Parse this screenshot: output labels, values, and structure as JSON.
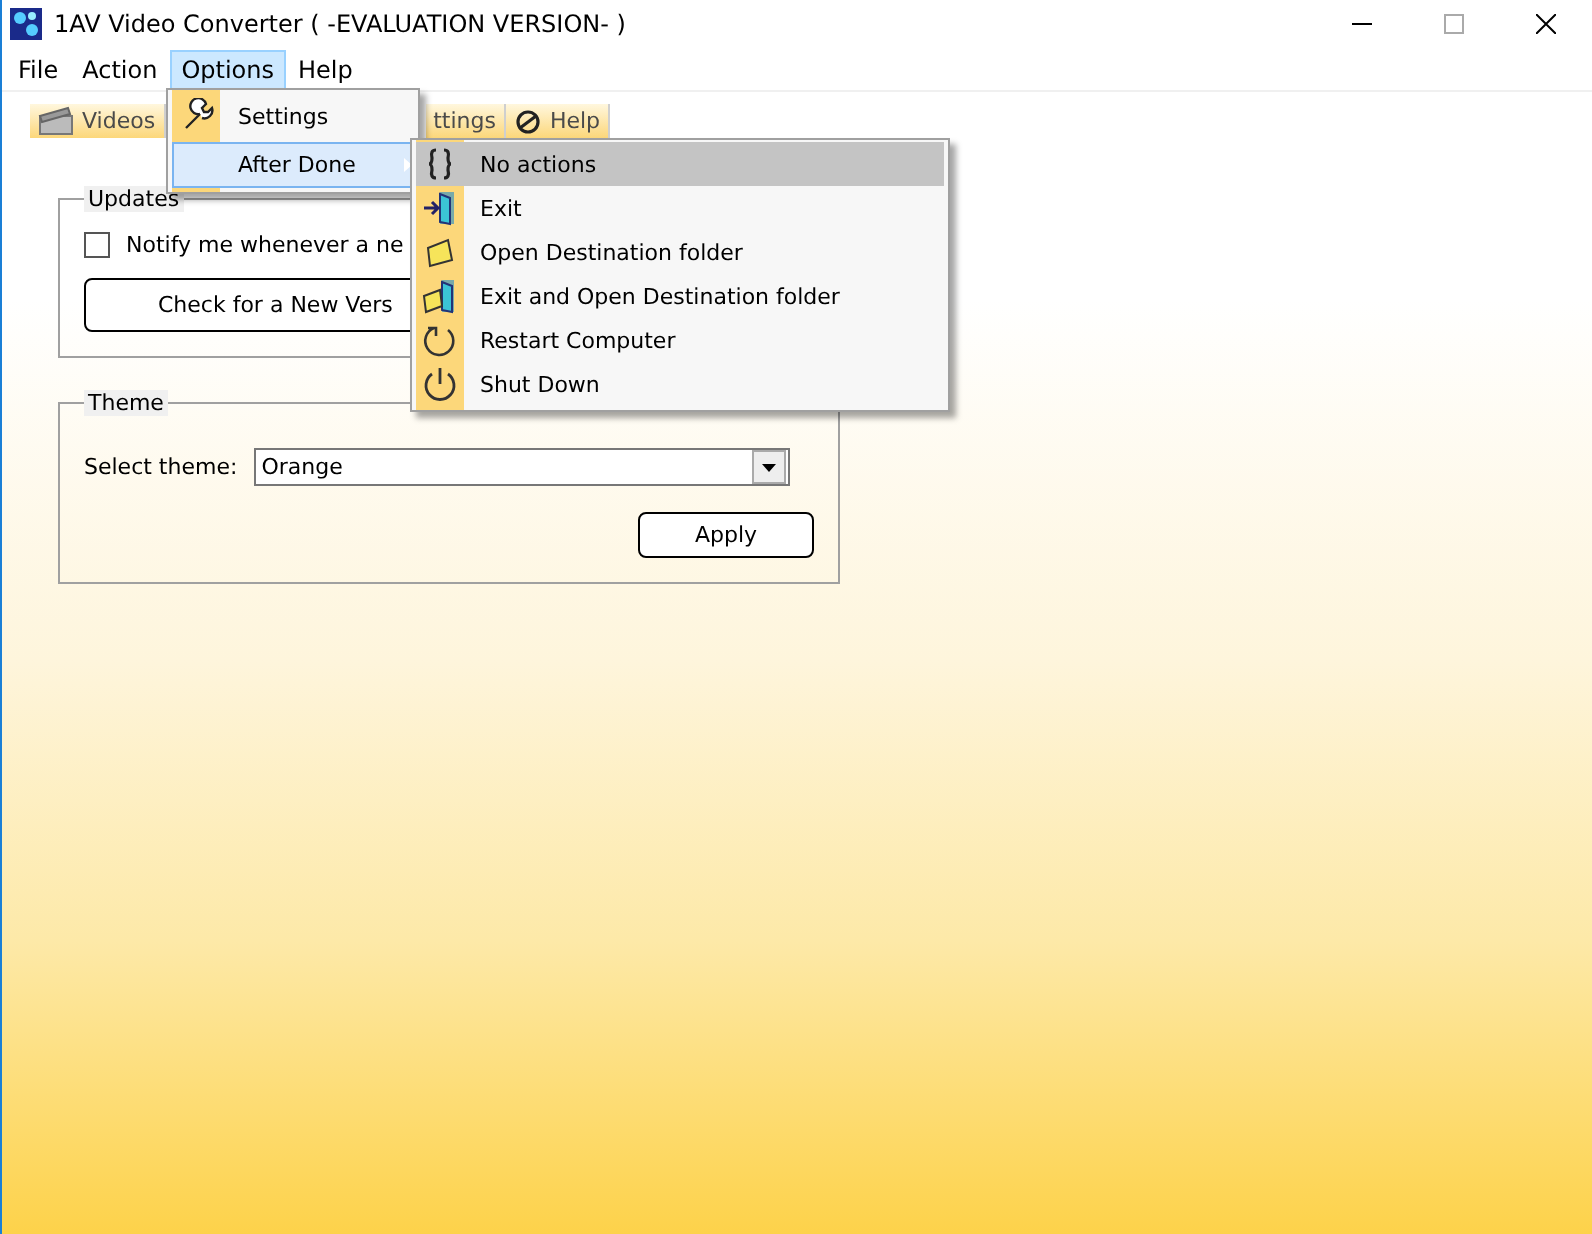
{
  "window": {
    "title": "1AV Video Converter ( -EVALUATION VERSION- )"
  },
  "menubar": [
    {
      "label": "File",
      "selected": false
    },
    {
      "label": "Action",
      "selected": false
    },
    {
      "label": "Options",
      "selected": true
    },
    {
      "label": "Help",
      "selected": false
    }
  ],
  "tabs": [
    {
      "label": "Videos"
    },
    {
      "label": "ttings"
    },
    {
      "label": "Help"
    }
  ],
  "updates": {
    "title": "Updates",
    "notify": {
      "label": "Notify me whenever a ne",
      "checked": false
    },
    "button": "Check for a New Vers"
  },
  "theme": {
    "title": "Theme",
    "label": "Select theme:",
    "value": "Orange",
    "button": "Apply"
  },
  "options_menu": [
    {
      "label": "Settings",
      "kind": "plain",
      "selected": false
    },
    {
      "label": "After Done",
      "kind": "submenu",
      "selected": true
    }
  ],
  "after_done_menu": [
    {
      "label": "No actions",
      "selected": true
    },
    {
      "label": "Exit",
      "selected": false
    },
    {
      "label": "Open Destination folder",
      "selected": false
    },
    {
      "label": "Exit and Open Destination folder",
      "selected": false
    },
    {
      "label": "Restart Computer",
      "selected": false
    },
    {
      "label": "Shut Down",
      "selected": false
    }
  ]
}
